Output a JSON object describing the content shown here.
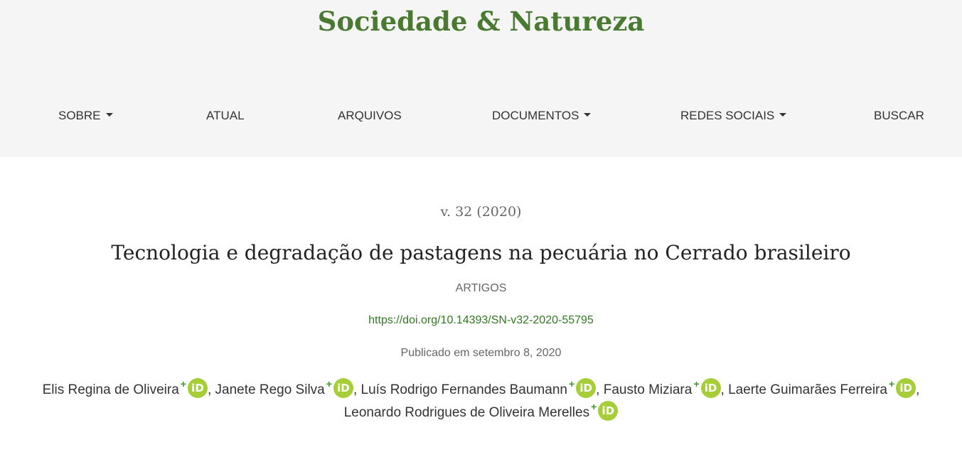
{
  "site": {
    "title": "Sociedade & Natureza",
    "brand_color": "#4a7a32"
  },
  "nav": {
    "items": [
      {
        "label": "SOBRE",
        "has_dropdown": true
      },
      {
        "label": "ATUAL",
        "has_dropdown": false
      },
      {
        "label": "ARQUIVOS",
        "has_dropdown": false
      },
      {
        "label": "DOCUMENTOS",
        "has_dropdown": true
      },
      {
        "label": "REDES SOCIAIS",
        "has_dropdown": true
      },
      {
        "label": "BUSCAR",
        "has_dropdown": false
      }
    ]
  },
  "article": {
    "issue": "v. 32 (2020)",
    "title": "Tecnologia e degradação de pastagens na pecuária no Cerrado brasileiro",
    "section": "ARTIGOS",
    "doi": "https://doi.org/10.14393/SN-v32-2020-55795",
    "published": "Publicado em setembro 8, 2020",
    "authors": [
      {
        "name": "Elis Regina de Oliveira",
        "orcid_icon": "orcid-icon"
      },
      {
        "name": "Janete Rego Silva",
        "orcid_icon": "orcid-icon"
      },
      {
        "name": "Luís Rodrigo Fernandes Baumann",
        "orcid_icon": "orcid-icon"
      },
      {
        "name": "Fausto Miziara",
        "orcid_icon": "orcid-icon"
      },
      {
        "name": "Laerte Guimarães Ferreira",
        "orcid_icon": "orcid-icon"
      },
      {
        "name": "Leonardo Rodrigues de Oliveira Merelles",
        "orcid_icon": "orcid-icon"
      }
    ],
    "author_expand_symbol": "+",
    "orcid_label": "iD",
    "author_separator": ","
  },
  "colors": {
    "header_bg": "#f5f5f5",
    "doi_link": "#2f7a1f",
    "orcid_badge": "#a6ce39",
    "expand_plus": "#3c9a28"
  }
}
